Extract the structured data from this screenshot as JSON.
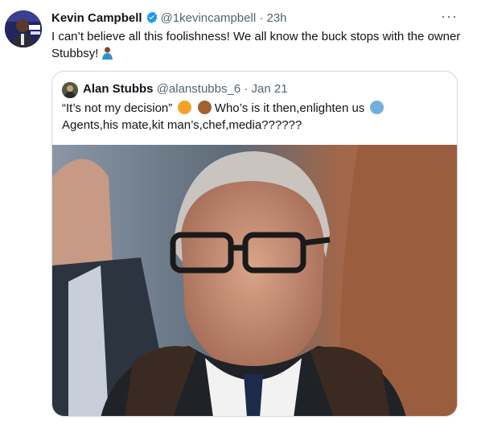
{
  "tweet": {
    "author_name": "Kevin Campbell",
    "handle": "@1kevincampbell",
    "separator": "·",
    "time": "23h",
    "text": "I can’t believe all this foolishness! We all know the buck stops with the owner Stubbsy!",
    "more_label": "···"
  },
  "quote": {
    "author_name": "Alan Stubbs",
    "handle": "@alanstubbs_6",
    "separator": "·",
    "date": "Jan 21",
    "line1": "“It’s not my decision”",
    "line1_b": "Who’s is it then,enlighten us",
    "line2": "Agents,his mate,kit man’s,chef,media??????"
  },
  "colors": {
    "verified": "#1d9bf0",
    "muted": "#536471",
    "border": "#cfd9de"
  },
  "icons": {
    "verified": "verified-badge-icon",
    "more": "more-horizontal-icon"
  }
}
